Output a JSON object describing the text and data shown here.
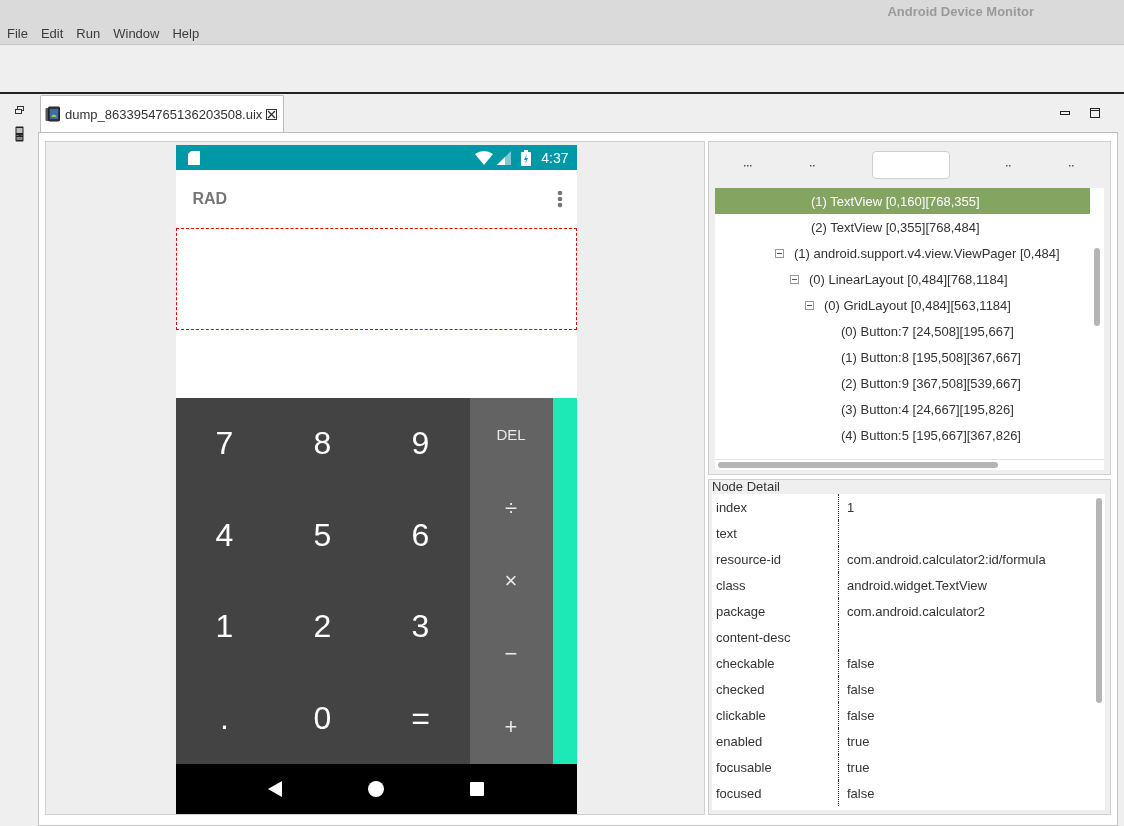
{
  "window": {
    "title": "Android Device Monitor"
  },
  "menu": [
    "File",
    "Edit",
    "Run",
    "Window",
    "Help"
  ],
  "editor_tab": {
    "label": "dump_8633954765136203508.uix",
    "selected": true
  },
  "device_screen": {
    "status_bar": {
      "time": "4:37"
    },
    "action_bar": {
      "title": "RAD"
    },
    "keypad": {
      "digits": [
        "7",
        "8",
        "9",
        "4",
        "5",
        "6",
        "1",
        "2",
        "3",
        ".",
        "0",
        "="
      ],
      "operators": [
        "DEL",
        "÷",
        "×",
        "−",
        "+"
      ]
    }
  },
  "hierarchy_tree": {
    "items": [
      {
        "children": [
          {
            "label": "(1) TextView [0,160][768,355]",
            "selected": true
          },
          {
            "label": "(2) TextView [0,355][768,484]",
            "selected": false
          }
        ]
      },
      {
        "label": "(1) android.support.v4.view.ViewPager [0,484]",
        "selected": false,
        "expanded": true,
        "children": [
          {
            "label": "(0) LinearLayout [0,484][768,1184]",
            "selected": false,
            "expanded": true,
            "children": [
              {
                "label": "(0) GridLayout [0,484][563,1184]",
                "selected": false,
                "expanded": true,
                "children": [
                  {
                    "label": "(0) Button:7 [24,508][195,667]",
                    "selected": false
                  },
                  {
                    "label": "(1) Button:8 [195,508][367,667]",
                    "selected": false
                  },
                  {
                    "label": "(2) Button:9 [367,508][539,667]",
                    "selected": false
                  },
                  {
                    "label": "(3) Button:4 [24,667][195,826]",
                    "selected": false
                  },
                  {
                    "label": "(4) Button:5 [195,667][367,826]",
                    "selected": false
                  }
                ]
              }
            ]
          }
        ]
      }
    ]
  },
  "node_detail": {
    "title": "Node Detail",
    "rows": [
      {
        "key": "index",
        "value": "1"
      },
      {
        "key": "text"
      },
      {
        "key": "resource-id",
        "value": "com.android.calculator2:id/formula"
      },
      {
        "key": "class",
        "value": "android.widget.TextView"
      },
      {
        "key": "package",
        "value": "com.android.calculator2"
      },
      {
        "key": "content-desc"
      },
      {
        "key": "checkable",
        "value": "false"
      },
      {
        "key": "checked",
        "value": "false"
      },
      {
        "key": "clickable",
        "value": "false"
      },
      {
        "key": "enabled",
        "value": "true"
      },
      {
        "key": "focusable",
        "value": "true"
      },
      {
        "key": "focused",
        "value": "false"
      }
    ]
  }
}
